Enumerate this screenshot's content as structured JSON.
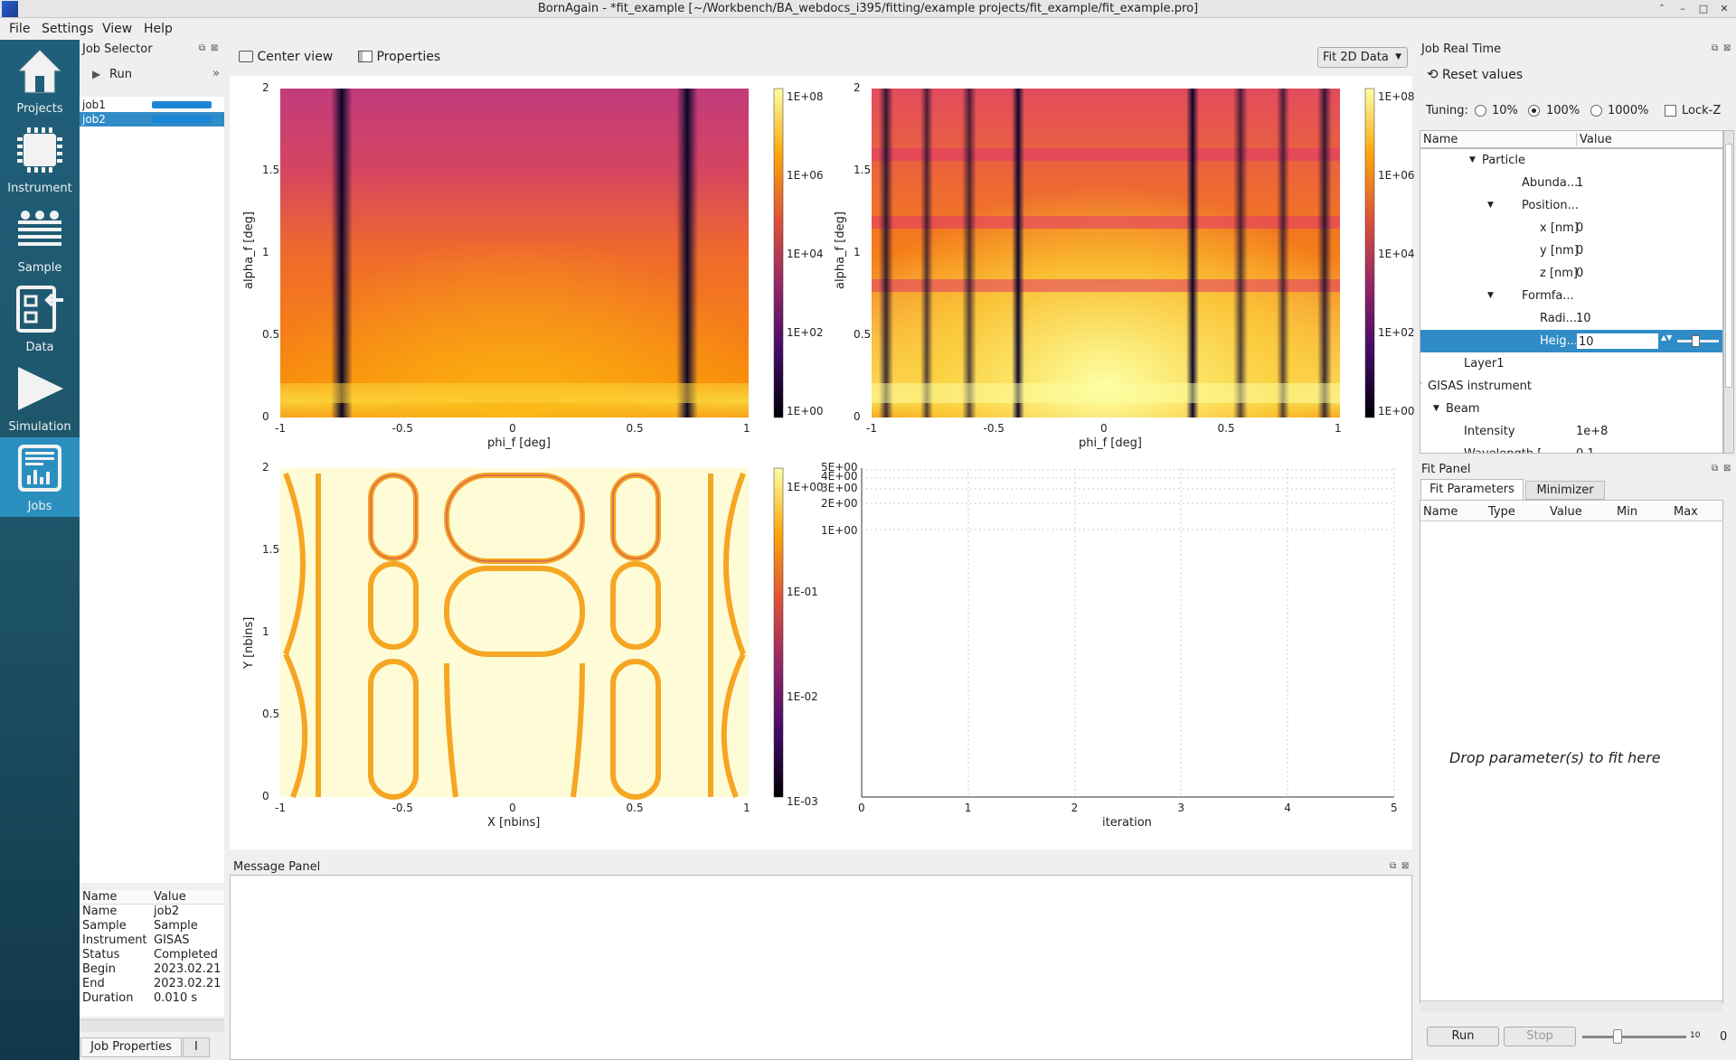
{
  "window": {
    "title": "BornAgain - *fit_example [~/Workbench/BA_webdocs_i395/fitting/example projects/fit_example/fit_example.pro]",
    "controls": [
      "˄",
      "–",
      "□",
      "✕"
    ]
  },
  "menu": [
    "File",
    "Settings",
    "View",
    "Help"
  ],
  "sidebar": {
    "items": [
      {
        "label": "Projects",
        "icon": "house-icon"
      },
      {
        "label": "Instrument",
        "icon": "chip-icon"
      },
      {
        "label": "Sample",
        "icon": "layers-icon"
      },
      {
        "label": "Data",
        "icon": "import-data-icon"
      },
      {
        "label": "Simulation",
        "icon": "play-icon"
      },
      {
        "label": "Jobs",
        "icon": "report-chart-icon"
      }
    ],
    "active": "Jobs"
  },
  "job_selector": {
    "title": "Job Selector",
    "run_label": "Run",
    "more": "»",
    "jobs": [
      {
        "name": "job1",
        "progress": 1.0
      },
      {
        "name": "job2",
        "progress": 1.0
      }
    ],
    "selected": "job2",
    "properties": {
      "headers": [
        "Name",
        "Value"
      ],
      "rows": [
        [
          "Name",
          "job2"
        ],
        [
          "Sample",
          "Sample"
        ],
        [
          "Instrument",
          "GISAS"
        ],
        [
          "Status",
          "Completed"
        ],
        [
          "Begin",
          "2023.02.21"
        ],
        [
          "End",
          "2023.02.21"
        ],
        [
          "Duration",
          "0.010 s"
        ]
      ]
    },
    "bottom_tab": "Job Properties",
    "bottom_tab2": "I"
  },
  "toolbar": {
    "center_view": "Center view",
    "properties": "Properties",
    "mode": "Fit 2D Data"
  },
  "plots": {
    "top_left": {
      "xlabel": "phi_f [deg]",
      "ylabel": "alpha_f [deg]",
      "xticks": [
        "-1",
        "-0.5",
        "0",
        "0.5",
        "1"
      ],
      "yticks": [
        "0",
        "0.5",
        "1",
        "1.5",
        "2"
      ],
      "cbticks": [
        "1E+08",
        "1E+06",
        "1E+04",
        "1E+02",
        "1E+00"
      ]
    },
    "top_right": {
      "xlabel": "phi_f [deg]",
      "ylabel": "alpha_f [deg]",
      "xticks": [
        "-1",
        "-0.5",
        "0",
        "0.5",
        "1"
      ],
      "yticks": [
        "0",
        "0.5",
        "1",
        "1.5",
        "2"
      ],
      "cbticks": [
        "1E+08",
        "1E+06",
        "1E+04",
        "1E+02",
        "1E+00"
      ]
    },
    "bottom_left": {
      "xlabel": "X [nbins]",
      "ylabel": "Y [nbins]",
      "xticks": [
        "-1",
        "-0.5",
        "0",
        "0.5",
        "1"
      ],
      "yticks": [
        "0",
        "0.5",
        "1",
        "1.5",
        "2"
      ],
      "cbticks": [
        "1E+00",
        "1E-01",
        "1E-02",
        "1E-03"
      ]
    },
    "bottom_right": {
      "xlabel": "iteration",
      "xticks": [
        "0",
        "1",
        "2",
        "3",
        "4",
        "5"
      ],
      "yticks": [
        "5E+00",
        "4E+00",
        "3E+00",
        "2E+00",
        "1E+00"
      ]
    }
  },
  "message_panel": {
    "title": "Message Panel"
  },
  "job_realtime": {
    "title": "Job Real Time",
    "reset": "Reset values",
    "tuning_label": "Tuning:",
    "tuning_options": [
      "10%",
      "100%",
      "1000%"
    ],
    "tuning_selected": "100%",
    "lockz": "Lock-Z",
    "headers": [
      "Name",
      "Value"
    ],
    "rows": [
      {
        "name": "Particle",
        "value": "",
        "level": 3,
        "expand": true
      },
      {
        "name": "Abunda...",
        "value": "1",
        "level": 4
      },
      {
        "name": "Position...",
        "value": "",
        "level": 4,
        "expand": true
      },
      {
        "name": "x [nm]",
        "value": "0",
        "level": 5
      },
      {
        "name": "y [nm]",
        "value": "0",
        "level": 5
      },
      {
        "name": "z [nm]",
        "value": "0",
        "level": 5
      },
      {
        "name": "Formfa...",
        "value": "",
        "level": 4,
        "expand": true
      },
      {
        "name": "Radi...",
        "value": "10",
        "level": 5
      },
      {
        "name": "Heig...",
        "value": "10",
        "level": 5,
        "selected": true
      },
      {
        "name": "Layer1",
        "value": "",
        "level": 2
      },
      {
        "name": "GISAS instrument",
        "value": "",
        "level": 0,
        "expand": true
      },
      {
        "name": "Beam",
        "value": "",
        "level": 1,
        "expand": true
      },
      {
        "name": "Intensity",
        "value": "1e+8",
        "level": 2
      },
      {
        "name": "Wavelength [",
        "value": "0.1",
        "level": 2
      }
    ]
  },
  "fit_panel": {
    "title": "Fit Panel",
    "tabs": [
      "Fit Parameters",
      "Minimizer"
    ],
    "headers": [
      "Name",
      "Type",
      "Value",
      "Min",
      "Max"
    ],
    "placeholder": "Drop parameter(s) to fit here",
    "run": "Run",
    "stop": "Stop",
    "slider_max": "10",
    "counter": "0"
  }
}
